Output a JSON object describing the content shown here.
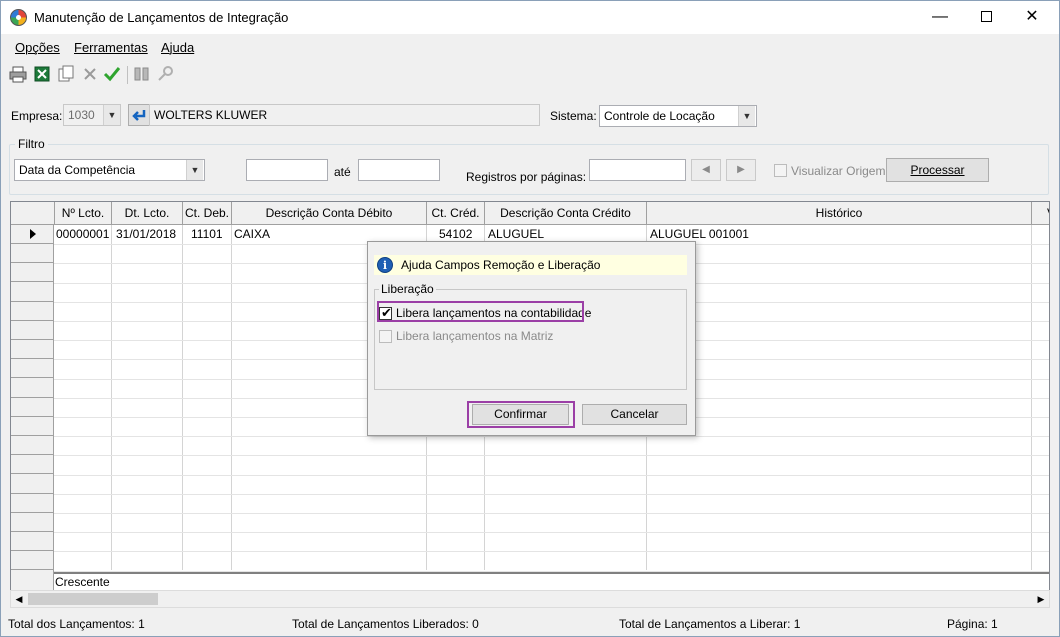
{
  "window": {
    "title": "Manutenção de Lançamentos de Integração",
    "min_glyph": "—",
    "close_glyph": "✕"
  },
  "menu": [
    "Opções",
    "Ferramentas",
    "Ajuda"
  ],
  "toolbar": {
    "icons": [
      "printer-icon",
      "excel-export-icon",
      "copy-icon",
      "delete-x-icon",
      "confirm-check-icon",
      "columns-icon",
      "search-key-icon"
    ],
    "check_color": "#2fa52f"
  },
  "empresa": {
    "label": "Empresa:",
    "code": "1030",
    "name": "WOLTERS KLUWER"
  },
  "sistema": {
    "label": "Sistema:",
    "value": "Controle de Locação"
  },
  "filtro": {
    "legend": "Filtro",
    "tipo": "Data da Competência",
    "data_inicio": "",
    "ate_label": "até",
    "data_fim": "",
    "registros_label": "Registros por páginas:",
    "registros_value": "",
    "prev_glyph": "◀",
    "next_glyph": "▶",
    "visualizar_label": "Visualizar Origem",
    "processar_label": "Processar"
  },
  "grid": {
    "columns": [
      "Nº Lcto.",
      "Dt. Lcto.",
      "Ct. Deb.",
      "Descrição Conta Débito",
      "Ct. Créd.",
      "Descrição Conta Crédito",
      "Histórico",
      "V"
    ],
    "rows": [
      [
        "00000001",
        "31/01/2018",
        "11101",
        "CAIXA",
        "54102",
        "ALUGUEL",
        "ALUGUEL 001001",
        ""
      ]
    ],
    "footer": "Crescente"
  },
  "status": {
    "total_lancamentos": "Total dos Lançamentos: 1",
    "total_liberados": "Total de Lançamentos Liberados: 0",
    "total_a_liberar": "Total de Lançamentos a Liberar: 1",
    "pagina": "Página: 1"
  },
  "dialog": {
    "info_text": "Ajuda Campos Remoção e Liberação",
    "group_legend": "Liberação",
    "option1": "Libera lançamentos na contabilidade",
    "option1_checked": true,
    "option2": "Libera lançamentos na Matriz",
    "option2_checked": false,
    "confirm_label": "Confirmar",
    "cancel_label": "Cancelar",
    "highlight_color": "#9b3fa6"
  }
}
